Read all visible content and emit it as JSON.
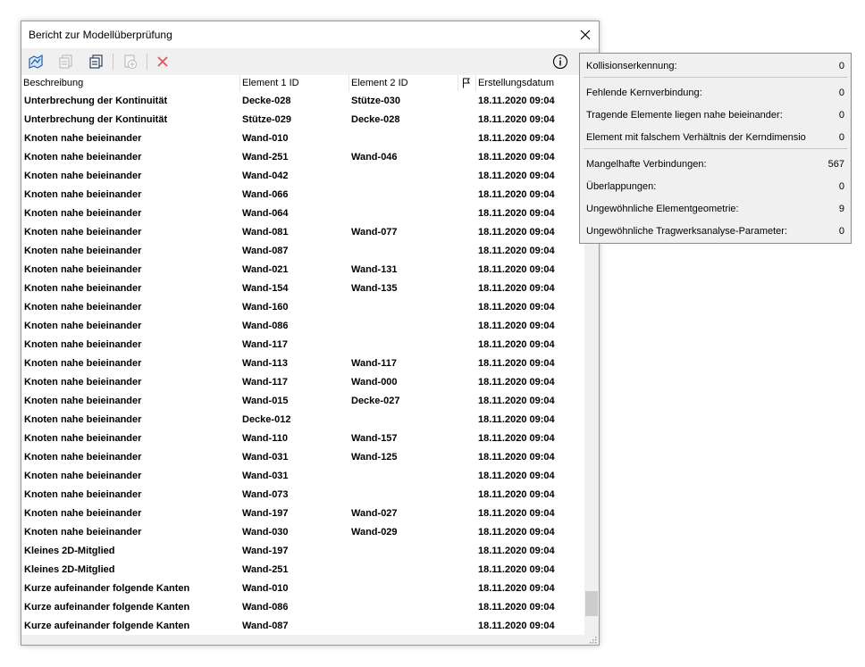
{
  "window": {
    "title": "Bericht zur Modellüberprüfung"
  },
  "toolbar": {
    "buttons": [
      {
        "icon": "structure-map-icon",
        "enabled": true
      },
      {
        "icon": "copy-document-icon",
        "enabled": false
      },
      {
        "icon": "document-stack-icon",
        "enabled": true
      },
      {
        "icon": "add-document-icon",
        "enabled": false
      },
      {
        "icon": "delete-x-icon",
        "enabled": false
      }
    ],
    "info_icon": "info-icon"
  },
  "table": {
    "columns": [
      "Beschreibung",
      "Element 1 ID",
      "Element 2 ID",
      "",
      "Erstellungsdatum"
    ],
    "rows": [
      [
        "Unterbrechung der Kontinuität",
        "Decke-028",
        "Stütze-030",
        "18.11.2020 09:04"
      ],
      [
        "Unterbrechung der Kontinuität",
        "Stütze-029",
        "Decke-028",
        "18.11.2020 09:04"
      ],
      [
        "Knoten nahe beieinander",
        "Wand-010",
        "",
        "18.11.2020 09:04"
      ],
      [
        "Knoten nahe beieinander",
        "Wand-251",
        "Wand-046",
        "18.11.2020 09:04"
      ],
      [
        "Knoten nahe beieinander",
        "Wand-042",
        "",
        "18.11.2020 09:04"
      ],
      [
        "Knoten nahe beieinander",
        "Wand-066",
        "",
        "18.11.2020 09:04"
      ],
      [
        "Knoten nahe beieinander",
        "Wand-064",
        "",
        "18.11.2020 09:04"
      ],
      [
        "Knoten nahe beieinander",
        "Wand-081",
        "Wand-077",
        "18.11.2020 09:04"
      ],
      [
        "Knoten nahe beieinander",
        "Wand-087",
        "",
        "18.11.2020 09:04"
      ],
      [
        "Knoten nahe beieinander",
        "Wand-021",
        "Wand-131",
        "18.11.2020 09:04"
      ],
      [
        "Knoten nahe beieinander",
        "Wand-154",
        "Wand-135",
        "18.11.2020 09:04"
      ],
      [
        "Knoten nahe beieinander",
        "Wand-160",
        "",
        "18.11.2020 09:04"
      ],
      [
        "Knoten nahe beieinander",
        "Wand-086",
        "",
        "18.11.2020 09:04"
      ],
      [
        "Knoten nahe beieinander",
        "Wand-117",
        "",
        "18.11.2020 09:04"
      ],
      [
        "Knoten nahe beieinander",
        "Wand-113",
        "Wand-117",
        "18.11.2020 09:04"
      ],
      [
        "Knoten nahe beieinander",
        "Wand-117",
        "Wand-000",
        "18.11.2020 09:04"
      ],
      [
        "Knoten nahe beieinander",
        "Wand-015",
        "Decke-027",
        "18.11.2020 09:04"
      ],
      [
        "Knoten nahe beieinander",
        "Decke-012",
        "",
        "18.11.2020 09:04"
      ],
      [
        "Knoten nahe beieinander",
        "Wand-110",
        "Wand-157",
        "18.11.2020 09:04"
      ],
      [
        "Knoten nahe beieinander",
        "Wand-031",
        "Wand-125",
        "18.11.2020 09:04"
      ],
      [
        "Knoten nahe beieinander",
        "Wand-031",
        "",
        "18.11.2020 09:04"
      ],
      [
        "Knoten nahe beieinander",
        "Wand-073",
        "",
        "18.11.2020 09:04"
      ],
      [
        "Knoten nahe beieinander",
        "Wand-197",
        "Wand-027",
        "18.11.2020 09:04"
      ],
      [
        "Knoten nahe beieinander",
        "Wand-030",
        "Wand-029",
        "18.11.2020 09:04"
      ],
      [
        "Kleines 2D-Mitglied",
        "Wand-197",
        "",
        "18.11.2020 09:04"
      ],
      [
        "Kleines 2D-Mitglied",
        "Wand-251",
        "",
        "18.11.2020 09:04"
      ],
      [
        "Kurze aufeinander folgende Kanten",
        "Wand-010",
        "",
        "18.11.2020 09:04"
      ],
      [
        "Kurze aufeinander folgende Kanten",
        "Wand-086",
        "",
        "18.11.2020 09:04"
      ],
      [
        "Kurze aufeinander folgende Kanten",
        "Wand-087",
        "",
        "18.11.2020 09:04"
      ]
    ]
  },
  "summary": {
    "groups": [
      [
        {
          "label": "Kollisionserkennung:",
          "value": "0"
        }
      ],
      [
        {
          "label": "Fehlende Kernverbindung:",
          "value": "0"
        },
        {
          "label": "Tragende Elemente liegen nahe beieinander:",
          "value": "0"
        },
        {
          "label": "Element mit falschem Verhältnis der Kerndimensio",
          "value": "0"
        }
      ],
      [
        {
          "label": "Mangelhafte Verbindungen:",
          "value": "567"
        },
        {
          "label": "Überlappungen:",
          "value": "0"
        },
        {
          "label": "Ungewöhnliche Elementgeometrie:",
          "value": "9"
        },
        {
          "label": "Ungewöhnliche Tragwerksanalyse-Parameter:",
          "value": "0"
        }
      ]
    ]
  },
  "colors": {
    "accent_blue": "#1f5fa8",
    "disabled_gray": "#b5b5b5",
    "delete_red": "#e0565b",
    "panel_bg": "#f0f0f0"
  }
}
